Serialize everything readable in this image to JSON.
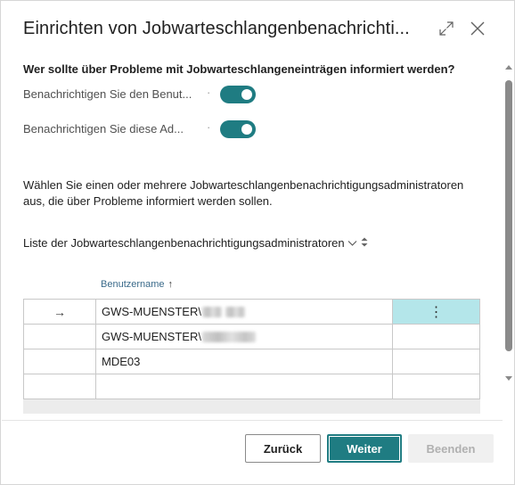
{
  "dialog": {
    "title": "Einrichten von Jobwarteschlangenbenachrichti...",
    "expand_icon": "expand-icon",
    "close_icon": "close-icon"
  },
  "question": "Wer sollte über Probleme mit Jobwarteschlangeneinträgen informiert werden?",
  "toggles": [
    {
      "label": "Benachrichtigen Sie den Benut...",
      "dots": "·",
      "on": true
    },
    {
      "label": "Benachrichtigen Sie diese Ad...",
      "dots": "·",
      "on": true
    }
  ],
  "description": "Wählen Sie einen oder mehrere Jobwarteschlangenbenachrichtigungsadministratoren aus, die über Probleme informiert werden sollen.",
  "list": {
    "title": "Liste der Jobwarteschlangenbenachrichtigungsadministratoren",
    "column_header": "Benutzername",
    "sort_arrow": "↑",
    "rows": [
      {
        "marker": "→",
        "username": "GWS-MUENSTER\\",
        "redacted": true,
        "menu": "⋮"
      },
      {
        "marker": "",
        "username": "GWS-MUENSTER\\",
        "redacted": true,
        "menu": ""
      },
      {
        "marker": "",
        "username": "MDE03",
        "redacted": false,
        "menu": ""
      },
      {
        "marker": "",
        "username": "",
        "redacted": false,
        "menu": ""
      }
    ]
  },
  "buttons": {
    "back": "Zurück",
    "next": "Weiter",
    "finish": "Beenden"
  },
  "colors": {
    "accent": "#1f7c82",
    "active_cell": "#b4e6ea",
    "disabled_button": "#f0f0f0"
  }
}
